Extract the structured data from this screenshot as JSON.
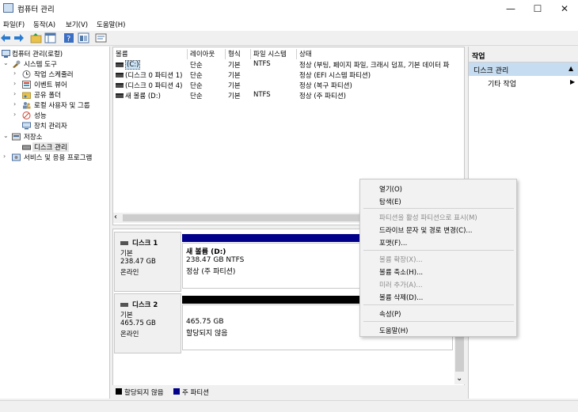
{
  "window": {
    "title": "컴퓨터 관리",
    "minimize": "—",
    "maximize": "☐",
    "close": "✕"
  },
  "menubar": [
    "파일(F)",
    "동작(A)",
    "보기(V)",
    "도움말(H)"
  ],
  "toolbar": {
    "icons": [
      "back-arrow-icon",
      "forward-arrow-icon",
      "folder-up-icon",
      "show-tree-icon",
      "help-icon",
      "view-icon",
      "properties-icon"
    ]
  },
  "tree": {
    "root": "컴퓨터 관리(로컬)",
    "system_tools": "시스템 도구",
    "task_scheduler": "작업 스케줄러",
    "event_viewer": "이벤트 뷰어",
    "shared_folders": "공유 폴더",
    "local_users": "로컬 사용자 및 그룹",
    "performance": "성능",
    "device_manager": "장치 관리자",
    "storage": "저장소",
    "disk_management": "디스크 관리",
    "services": "서비스 및 응용 프로그램",
    "expand_collapsed": "›",
    "expand_open": "⌄"
  },
  "volume_list": {
    "headers": [
      "볼륨",
      "레이아웃",
      "형식",
      "파일 시스템",
      "상태"
    ],
    "rows": [
      {
        "volume": "(C:)",
        "layout": "단순",
        "type": "기본",
        "fs": "NTFS",
        "status": "정상 (부팅, 페이지 파일, 크래시 덤프, 기본 데이터 파"
      },
      {
        "volume": "(디스크 0 파티션 1)",
        "layout": "단순",
        "type": "기본",
        "fs": "",
        "status": "정상 (EFI 시스템 파티션)"
      },
      {
        "volume": "(디스크 0 파티션 4)",
        "layout": "단순",
        "type": "기본",
        "fs": "",
        "status": "정상 (복구 파티션)"
      },
      {
        "volume": "새 볼륨 (D:)",
        "layout": "단순",
        "type": "기본",
        "fs": "NTFS",
        "status": "정상 (주 파티션)"
      }
    ]
  },
  "disks": [
    {
      "name": "디스크 1",
      "type": "기본",
      "size": "238.47 GB",
      "state": "온라인",
      "partition": {
        "title": "새 볼륨  (D:)",
        "detail": "238.47 GB NTFS",
        "status": "정상 (주 파티션)"
      }
    },
    {
      "name": "디스크 2",
      "type": "기본",
      "size": "465.75 GB",
      "state": "온라인",
      "partition": {
        "title": "",
        "detail": "465.75 GB",
        "status": "할당되지 않음"
      }
    }
  ],
  "legend": {
    "unallocated": "할당되지 않음",
    "primary": "주 파티션",
    "unallocated_color": "#000000",
    "primary_color": "#00008b"
  },
  "actions": {
    "header": "작업",
    "section": "디스크 관리",
    "more": "기타 작업",
    "collapse_arrow": "▲",
    "more_arrow": "▶"
  },
  "context_menu": {
    "open": "열기(O)",
    "explore": "탐색(E)",
    "mark_active": "파티션을 활성 파티션으로 표시(M)",
    "change_letter": "드라이브 문자 및 경로 변경(C)...",
    "format": "포맷(F)...",
    "extend": "볼륨 확장(X)...",
    "shrink": "볼륨 축소(H)...",
    "mirror": "미러 추가(A)...",
    "delete": "볼륨 삭제(D)...",
    "properties": "속성(P)",
    "help": "도움말(H)"
  },
  "scroll": {
    "left": "‹",
    "right": "›",
    "down": "⌄"
  }
}
